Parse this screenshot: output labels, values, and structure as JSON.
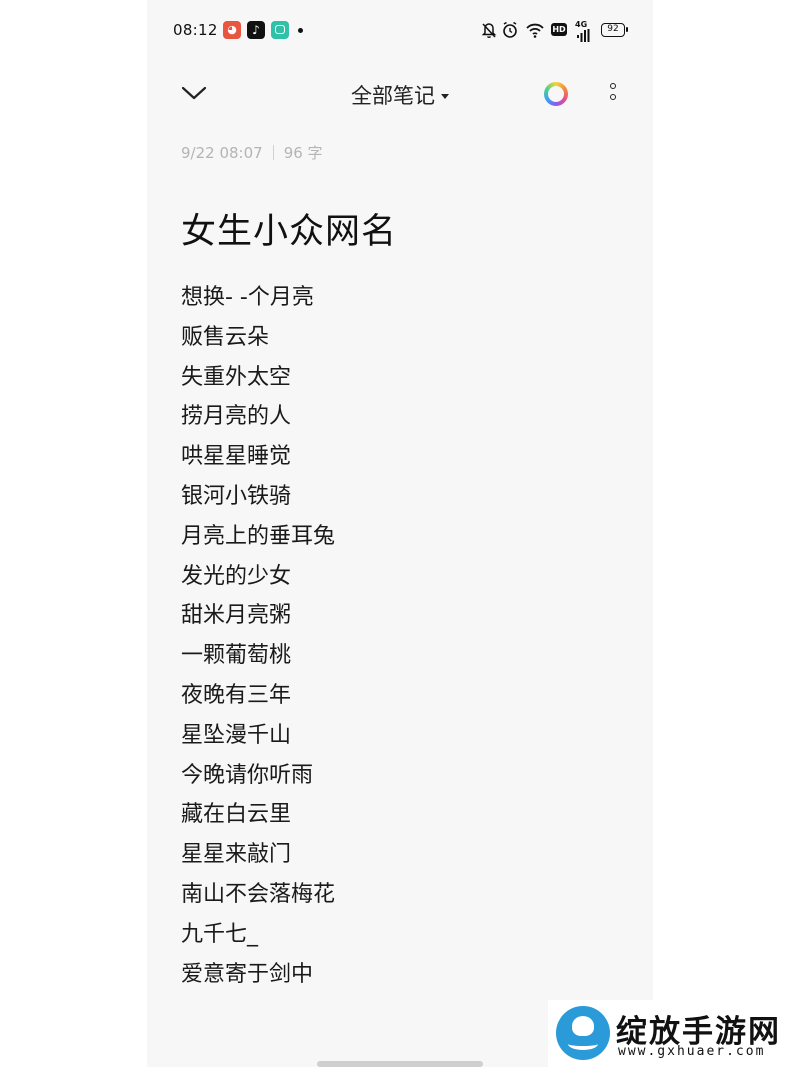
{
  "status_bar": {
    "time": "08:12",
    "battery": "92",
    "hd": "HD",
    "network": "4G",
    "icons": [
      "pig-app-icon",
      "tiktok-icon",
      "message-app-icon",
      "notification-dot",
      "bell-off-icon",
      "alarm-icon",
      "wifi-icon",
      "hd-icon",
      "signal-icon",
      "battery-icon"
    ]
  },
  "header": {
    "title": "全部笔记",
    "back_icon": "chevron-down-icon",
    "ring_icon": "color-ring-icon",
    "more_icon": "more-vertical-icon"
  },
  "note": {
    "date": "9/22 08:07",
    "word_count": "96 字",
    "title": "女生小众网名",
    "lines": [
      "想换- -个月亮",
      "贩售云朵",
      "失重外太空",
      "捞月亮的人",
      "哄星星睡觉",
      "银河小铁骑",
      "月亮上的垂耳兔",
      "发光的少女",
      "甜米月亮粥",
      "一颗葡萄桃",
      "夜晚有三年",
      "星坠漫千山",
      "今晚请你听雨",
      "藏在白云里",
      "星星来敲门",
      "南山不会落梅花",
      "九千七_",
      "爱意寄于剑中"
    ]
  },
  "watermark": {
    "name": "绽放手游网",
    "url": "www.gxhuaer.com"
  },
  "colors": {
    "background": "#f7f7f7",
    "text": "#1a1a1a",
    "meta": "#b4b4b4",
    "watermark_blue": "#2a9ad8"
  }
}
